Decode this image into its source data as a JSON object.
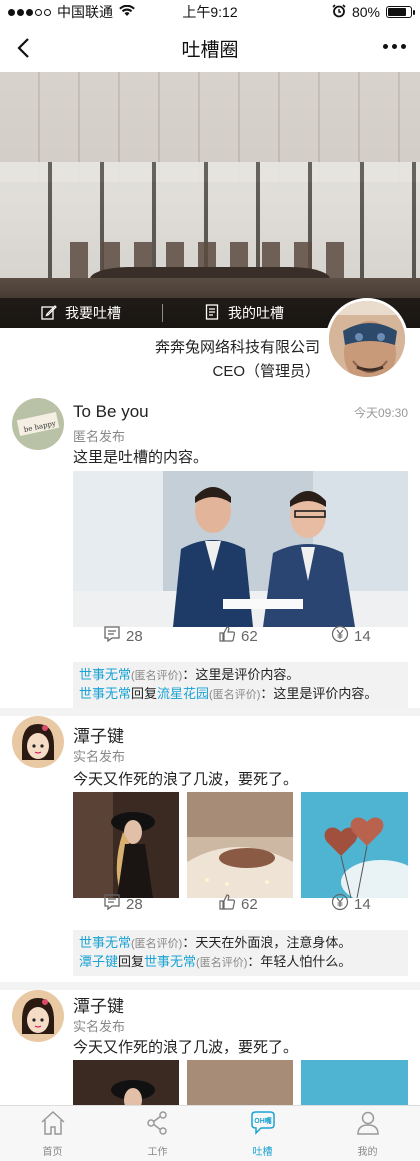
{
  "status_bar": {
    "carrier": "中国联通",
    "time": "上午9:12",
    "battery": "80%",
    "battery_level": 0.8
  },
  "nav": {
    "title": "吐槽圈"
  },
  "hero": {
    "action_left": "我要吐槽",
    "action_right": "我的吐槽"
  },
  "company": {
    "name": "奔奔兔网络科技有限公司",
    "role": "CEO（管理员）"
  },
  "posts": [
    {
      "name": "To Be you",
      "type": "匿名发布",
      "time": "今天09:30",
      "content": "这里是吐槽的内容。",
      "comments_count": "28",
      "likes_count": "62",
      "reward_count": "14",
      "comments": [
        {
          "user": "世事无常",
          "tag": "(匿名评价)",
          "text": "：这里是评价内容。"
        },
        {
          "user": "世事无常",
          "reply_word": "回复",
          "reply_to": "流星花园",
          "tag": "(匿名评价)",
          "text": "：这里是评价内容。"
        }
      ]
    },
    {
      "name": "潭子键",
      "type": "实名发布",
      "content": "今天又作死的浪了几波，要死了。",
      "comments_count": "28",
      "likes_count": "62",
      "reward_count": "14",
      "comments": [
        {
          "user": "世事无常",
          "tag": "(匿名评价)",
          "text": "：天天在外面浪，注意身体。"
        },
        {
          "user": "潭子键",
          "reply_word": "回复",
          "reply_to": "世事无常",
          "tag": "(匿名评价)",
          "text": "：年轻人怕什么。"
        }
      ]
    },
    {
      "name": "潭子键",
      "type": "实名发布",
      "content": "今天又作死的浪了几波，要死了。"
    }
  ],
  "tabs": [
    {
      "label": "首页",
      "icon": "home-icon"
    },
    {
      "label": "工作",
      "icon": "share-icon"
    },
    {
      "label": "吐槽",
      "icon": "speech-bubble-icon",
      "badge": "OH嘴",
      "active": true
    },
    {
      "label": "我的",
      "icon": "person-icon"
    }
  ],
  "colors": {
    "accent": "#1aa3d4",
    "text": "#222222",
    "muted": "#888888"
  },
  "avatar_text": "be happy"
}
